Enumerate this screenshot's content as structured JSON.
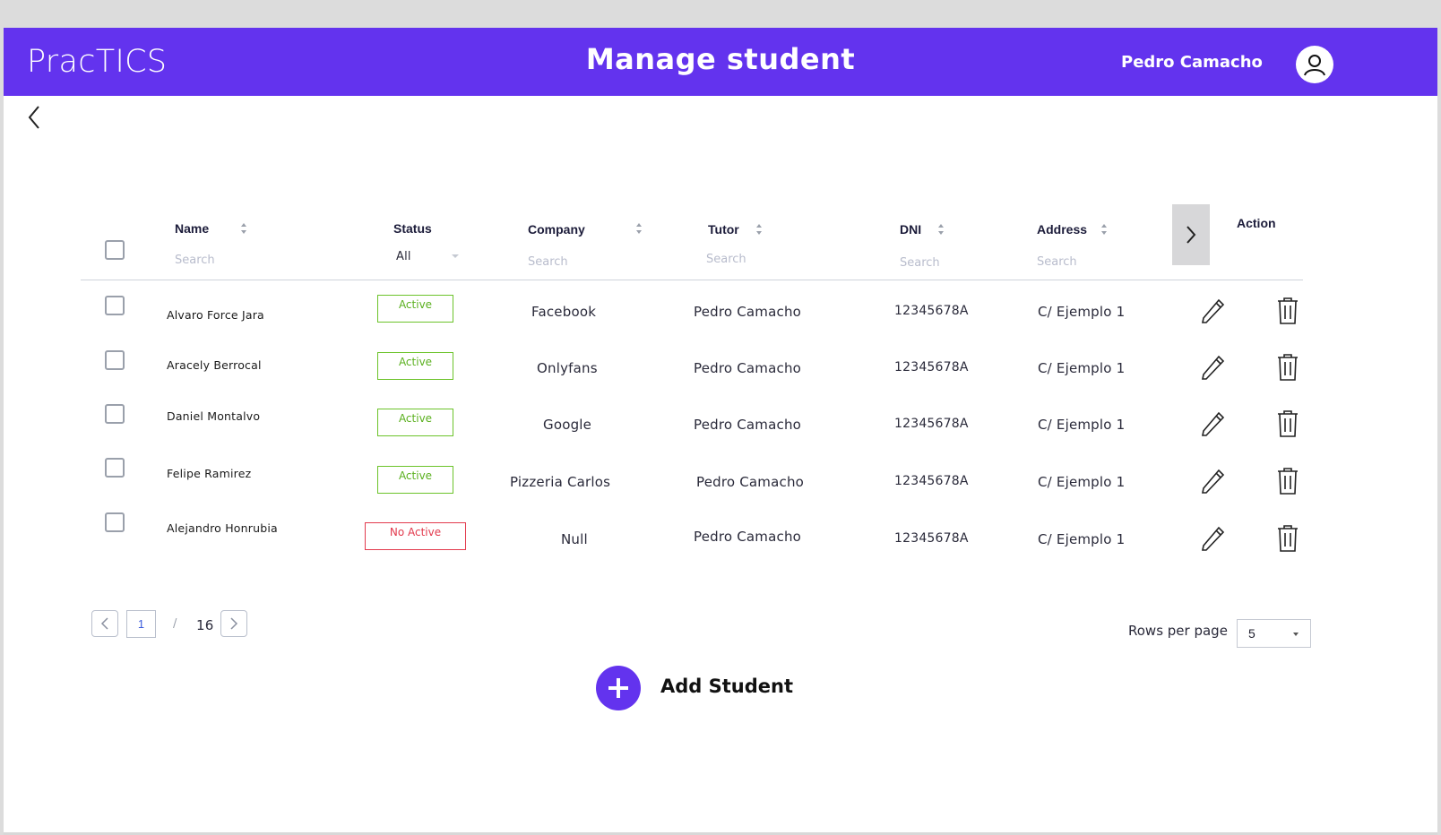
{
  "app": {
    "brand": "PracTICS",
    "title": "Manage student",
    "user": "Pedro Camacho"
  },
  "colors": {
    "primary": "#6333ee",
    "active": "#5ab01e",
    "inactive": "#e23a4d"
  },
  "table": {
    "columns": {
      "name": "Name",
      "status": "Status",
      "company": "Company",
      "tutor": "Tutor",
      "dni": "DNI",
      "address": "Address",
      "action": "Action"
    },
    "search_placeholder": "Search",
    "status_filter": "All",
    "rows": [
      {
        "name": "Alvaro Force Jara",
        "status": "Active",
        "company": "Facebook",
        "tutor": "Pedro Camacho",
        "dni": "12345678A",
        "address": "C/ Ejemplo 1"
      },
      {
        "name": "Aracely Berrocal",
        "status": "Active",
        "company": "Onlyfans",
        "tutor": "Pedro Camacho",
        "dni": "12345678A",
        "address": "C/ Ejemplo 1"
      },
      {
        "name": "Daniel Montalvo",
        "status": "Active",
        "company": "Google",
        "tutor": "Pedro Camacho",
        "dni": "12345678A",
        "address": "C/ Ejemplo 1"
      },
      {
        "name": "Felipe Ramirez",
        "status": "Active",
        "company": "Pizzeria Carlos",
        "tutor": "Pedro Camacho",
        "dni": "12345678A",
        "address": "C/ Ejemplo 1"
      },
      {
        "name": "Alejandro Honrubia",
        "status": "No Active",
        "company": "Null",
        "tutor": "Pedro Camacho",
        "dni": "12345678A",
        "address": "C/ Ejemplo 1"
      }
    ]
  },
  "pagination": {
    "current": "1",
    "separator": "/",
    "total": "16",
    "rows_label": "Rows per page",
    "rows_value": "5"
  },
  "actions": {
    "add_student": "Add Student"
  },
  "icons": {
    "back": "chevron-left-icon",
    "scroll": "chevron-right-icon",
    "edit": "pencil-icon",
    "delete": "trash-icon",
    "user": "user-icon",
    "add": "plus-icon"
  }
}
